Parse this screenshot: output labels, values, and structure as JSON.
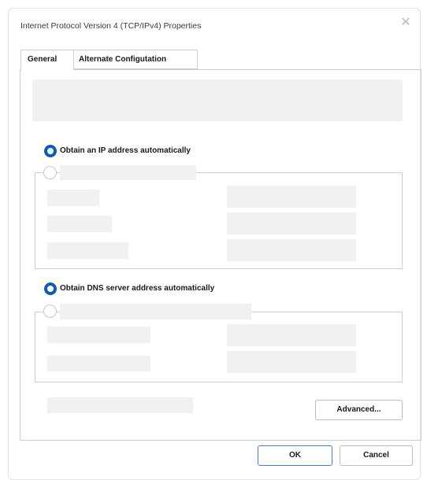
{
  "dialog": {
    "title": "Internet Protocol Version 4 (TCP/IPv4) Properties",
    "close_glyph": "✕"
  },
  "tabs": [
    {
      "label": "General",
      "selected": true
    },
    {
      "label": "Alternate Configutation",
      "selected": false
    }
  ],
  "ip": {
    "auto_label": "Obtain an IP address automatically",
    "auto_selected": true
  },
  "dns": {
    "auto_label": "Obtain DNS server address automatically",
    "auto_selected": true
  },
  "buttons": {
    "advanced": "Advanced...",
    "ok": "OK",
    "cancel": "Cancel"
  },
  "colors": {
    "accent": "#0f5da9",
    "placeholder": "#f1f1f1",
    "border": "#cfcfcf"
  }
}
